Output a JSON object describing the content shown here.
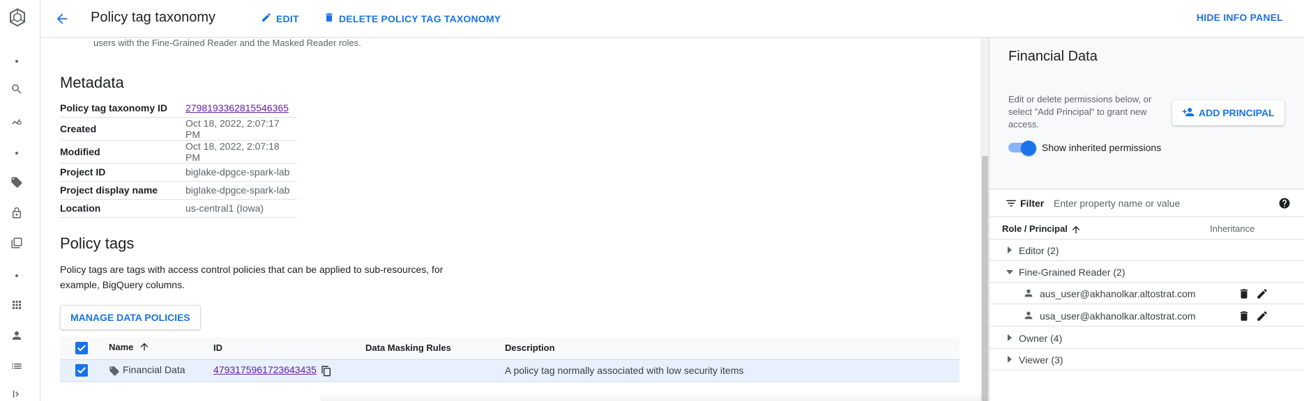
{
  "header": {
    "title": "Policy tag taxonomy",
    "edit_label": "EDIT",
    "delete_label": "DELETE POLICY TAG TAXONOMY",
    "hide_panel_label": "HIDE INFO PANEL"
  },
  "main": {
    "intro_text": "users with the Fine-Grained Reader and the Masked Reader roles.",
    "metadata": {
      "title": "Metadata",
      "rows": [
        {
          "key": "Policy tag taxonomy ID",
          "value": "2798193362815546365"
        },
        {
          "key": "Created",
          "value": "Oct 18, 2022, 2:07:17 PM"
        },
        {
          "key": "Modified",
          "value": "Oct 18, 2022, 2:07:18 PM"
        },
        {
          "key": "Project ID",
          "value": "biglake-dpgce-spark-lab"
        },
        {
          "key": "Project display name",
          "value": "biglake-dpgce-spark-lab"
        },
        {
          "key": "Location",
          "value": "us-central1 (Iowa)"
        }
      ]
    },
    "policy_tags": {
      "title": "Policy tags",
      "description": "Policy tags are tags with access control policies that can be applied to sub-resources, for example, BigQuery columns.",
      "manage_button": "MANAGE DATA POLICIES",
      "columns": [
        "Name",
        "ID",
        "Data Masking Rules",
        "Description"
      ],
      "rows": [
        {
          "name": "Financial Data",
          "id": "4793175961723643435",
          "masking": "",
          "description": "A policy tag normally associated with low security items"
        }
      ]
    }
  },
  "panel": {
    "title": "Financial Data",
    "help_text": "Edit or delete permissions below, or select \"Add Principal\" to grant new access.",
    "add_principal_label": "ADD PRINCIPAL",
    "toggle_label": "Show inherited permissions",
    "toggle_on": true,
    "filter_label": "Filter",
    "filter_placeholder": "Enter property name or value",
    "columns": {
      "role": "Role / Principal",
      "inheritance": "Inheritance"
    },
    "groups": [
      {
        "label": "Editor (2)",
        "expanded": false
      },
      {
        "label": "Fine-Grained Reader (2)",
        "expanded": true,
        "members": [
          "aus_user@akhanolkar.altostrat.com",
          "usa_user@akhanolkar.altostrat.com"
        ]
      },
      {
        "label": "Owner (4)",
        "expanded": false
      },
      {
        "label": "Viewer (3)",
        "expanded": false
      }
    ]
  },
  "colors": {
    "accent": "#1a73e8",
    "link": "#681da8",
    "row_selected": "#e8f0fe"
  }
}
